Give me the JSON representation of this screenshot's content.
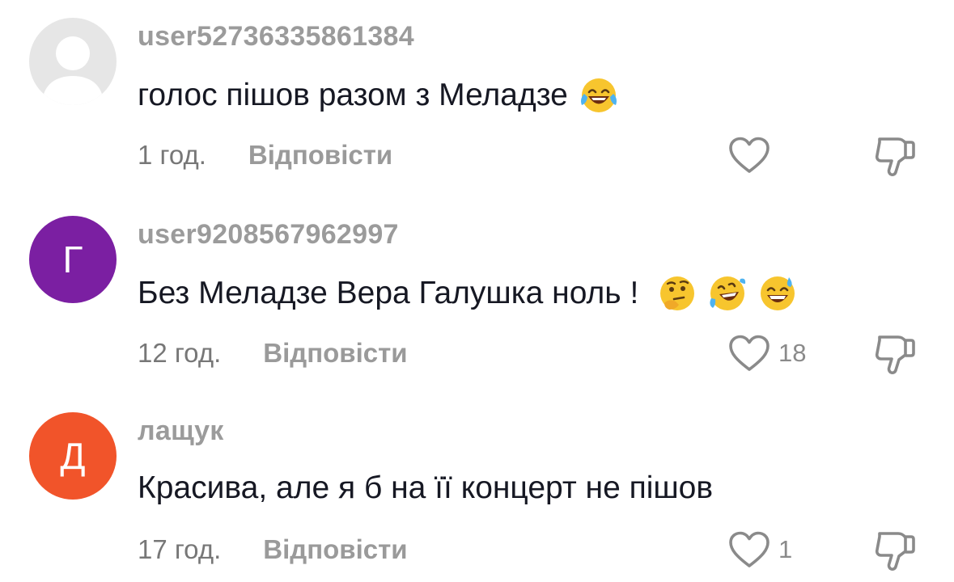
{
  "comments": [
    {
      "username": "user52736335861384",
      "avatar_type": "default-person-icon",
      "avatar_initial": "",
      "avatar_color": "#e6e6e6",
      "text": "голос пішов разом з Меладзе",
      "emojis": [
        "face-with-tears-of-joy"
      ],
      "time": "1 год.",
      "reply_label": "Відповісти",
      "likes": ""
    },
    {
      "username": "user9208567962997",
      "avatar_type": "initial",
      "avatar_initial": "Г",
      "avatar_color": "#7b1fa2",
      "text": "Без Меладзе Вера Галушка ноль !",
      "emojis": [
        "thinking-face",
        "rolling-on-floor-laughing",
        "grinning-face-with-sweat"
      ],
      "time": "12 год.",
      "reply_label": "Відповісти",
      "likes": "18"
    },
    {
      "username": "лащук",
      "avatar_type": "initial",
      "avatar_initial": "Д",
      "avatar_color": "#f1542a",
      "text": "Красива, але я б на її концерт не пішов",
      "emojis": [],
      "time": "17 год.",
      "reply_label": "Відповісти",
      "likes": "1"
    }
  ],
  "icons": {
    "like": "heart-outline-icon",
    "dislike": "thumbs-down-outline-icon"
  },
  "colors": {
    "username": "#9b9b9b",
    "text": "#161823",
    "meta": "#8a8a8a",
    "icon": "#8a8a8a"
  }
}
